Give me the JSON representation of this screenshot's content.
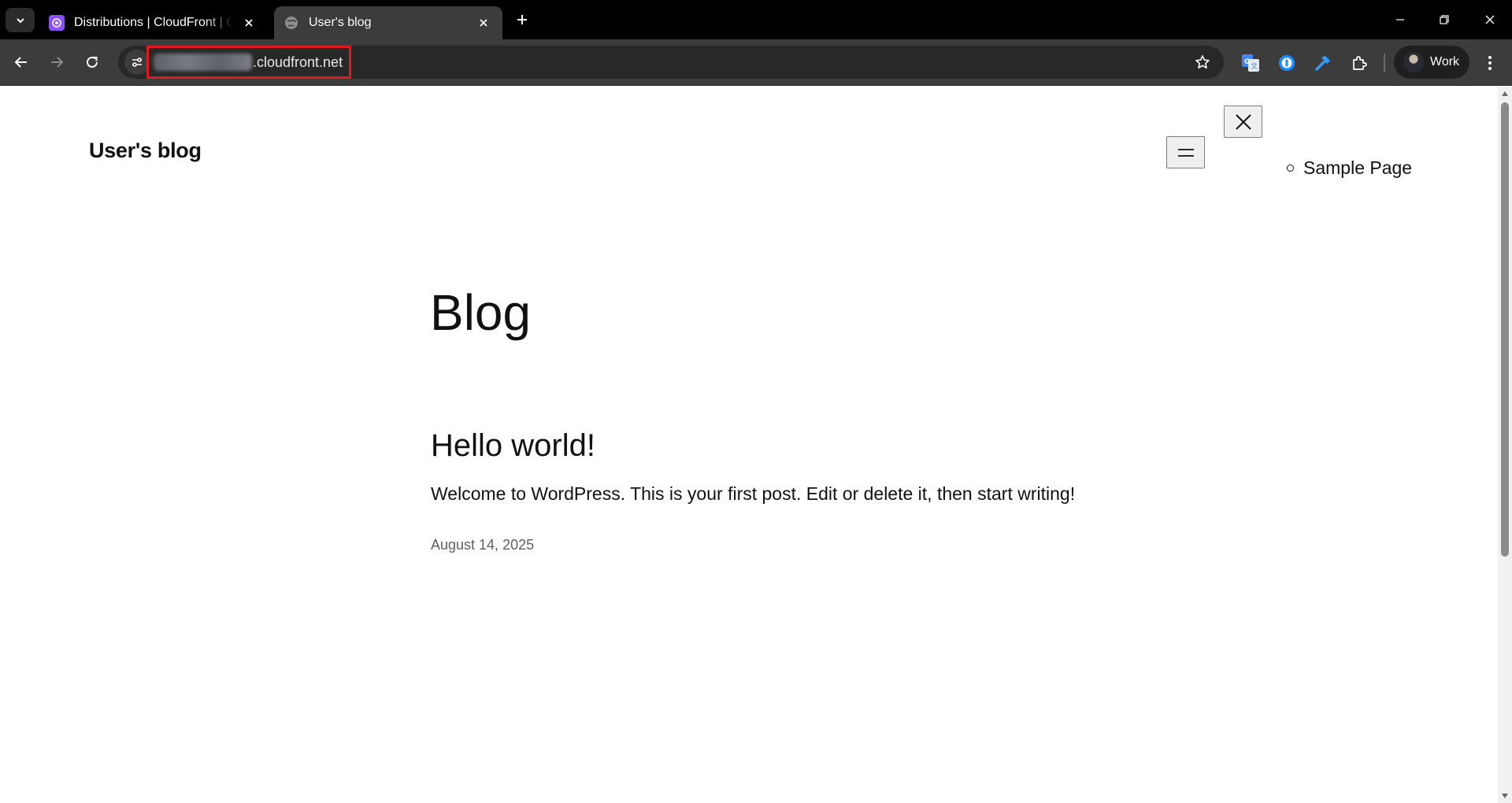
{
  "browser": {
    "tabs": [
      {
        "title": "Distributions | CloudFront | Global",
        "active": false
      },
      {
        "title": "User's blog",
        "active": true
      }
    ],
    "address_bar": {
      "url_visible": ".cloudfront.net",
      "url_redacted": true,
      "highlight_color": "#e0191f"
    },
    "profile": {
      "label": "Work"
    },
    "icons": {
      "tab_search": "chevron-down-icon",
      "back": "arrow-left-icon",
      "forward": "arrow-right-icon",
      "reload": "reload-icon",
      "site_info": "tune-icon",
      "bookmark": "star-icon",
      "extensions": [
        "google-translate-icon",
        "password-manager-icon",
        "hammer-icon",
        "puzzle-icon"
      ],
      "menu": "kebab-icon"
    }
  },
  "site": {
    "title": "User's blog",
    "nav": [
      {
        "label": "Sample Page"
      }
    ]
  },
  "main": {
    "heading": "Blog",
    "posts": [
      {
        "title": "Hello world!",
        "excerpt": "Welcome to WordPress. This is your first post. Edit or delete it, then start writing!",
        "date": "August 14, 2025"
      }
    ]
  }
}
